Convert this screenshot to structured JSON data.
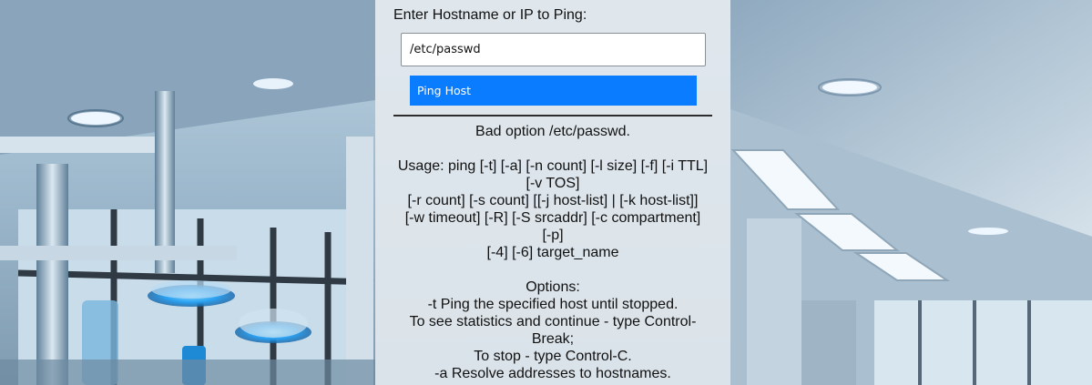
{
  "form": {
    "prompt_label": "Enter Hostname or IP to Ping:",
    "host_input_value": "/etc/passwd",
    "ping_button_label": "Ping Host"
  },
  "output": {
    "lines": [
      "Bad option /etc/passwd.",
      "",
      "Usage: ping [-t] [-a] [-n count] [-l size] [-f] [-i TTL]",
      "[-v TOS]",
      "[-r count] [-s count] [[-j host-list] | [-k host-list]]",
      "[-w timeout] [-R] [-S srcaddr] [-c compartment]",
      "[-p]",
      "[-4] [-6] target_name",
      "",
      "Options:",
      "-t Ping the specified host until stopped.",
      "To see statistics and continue - type Control-",
      "Break;",
      "To stop - type Control-C.",
      "-a Resolve addresses to hostnames."
    ]
  },
  "colors": {
    "button": "#0a7cff",
    "panel": "#e2e8ee",
    "accent_glow": "#3fb4ff"
  },
  "background": {
    "description_icon": "laboratory-scene-image"
  }
}
